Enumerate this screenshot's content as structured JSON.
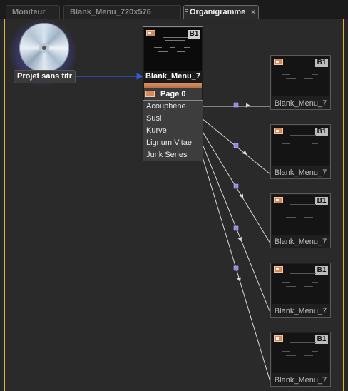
{
  "tabs": [
    {
      "label": "Moniteur"
    },
    {
      "label": "Blank_Menu_720x576"
    },
    {
      "label": "Organigramme",
      "close_glyph": "×"
    }
  ],
  "project": {
    "label": "Projet sans titr",
    "icon": "disc-icon"
  },
  "menu": {
    "title": "Blank_Menu_7",
    "badge": "B1",
    "page_label": "Page 0",
    "items": [
      {
        "label": "Acouphène"
      },
      {
        "label": "Susi"
      },
      {
        "label": "Kurve"
      },
      {
        "label": "Lignum Vitae"
      },
      {
        "label": "Junk Series"
      }
    ]
  },
  "targets": [
    {
      "title": "Blank_Menu_7",
      "badge": "B1"
    },
    {
      "title": "Blank_Menu_7",
      "badge": "B1"
    },
    {
      "title": "Blank_Menu_7",
      "badge": "B1"
    },
    {
      "title": "Blank_Menu_7",
      "badge": "B1"
    },
    {
      "title": "Blank_Menu_7",
      "badge": "B1"
    }
  ],
  "colors": {
    "active_frame": "#e0b23a",
    "project_link": "#2f5be0",
    "item_link": "#d8d8d8",
    "link_node": "#8f86e8",
    "menu_accent": "#d5885a"
  }
}
